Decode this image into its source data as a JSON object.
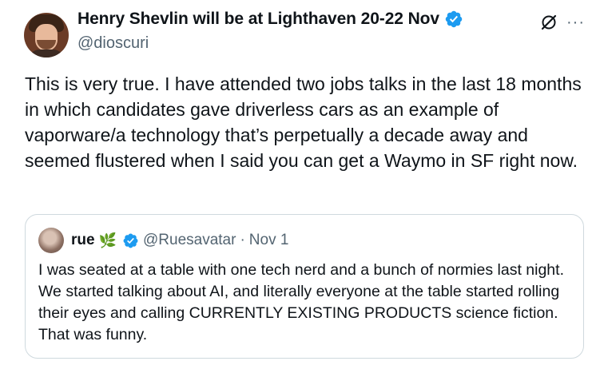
{
  "author": {
    "display_name": "Henry Shevlin will be at Lighthaven 20-22 Nov",
    "handle": "@dioscuri",
    "verified_icon": "verified-badge-icon",
    "avatar_icon": "profile-photo"
  },
  "actions": {
    "grok_icon": "grok-slash-icon",
    "more_icon": "more-options-icon",
    "more_glyph": "···"
  },
  "tweet": {
    "text": "This is very true. I have attended two jobs talks in the last 18 months in which candidates gave driverless cars as an example of vaporware/a technology that’s perpetually a decade away and seemed flustered when I said you can get a Waymo in SF right now."
  },
  "quoted": {
    "name": "rue",
    "emoji": "🌿",
    "handle": "@Ruesavatar",
    "separator": "·",
    "date": "Nov 1",
    "text": "I was seated at a table with one tech nerd and a bunch of normies last night. We started talking about AI, and literally everyone at the table started rolling their eyes and calling CURRENTLY EXISTING PRODUCTS science fiction. That was funny."
  },
  "colors": {
    "text": "#0f1419",
    "secondary": "#536471",
    "verified": "#1d9bf0",
    "border": "#cfd9de"
  }
}
